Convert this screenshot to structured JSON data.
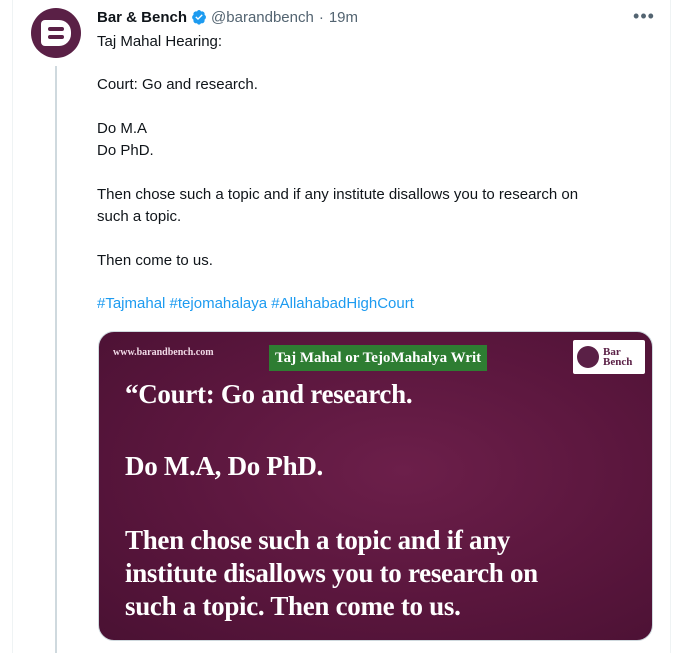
{
  "tweet": {
    "author_name": "Bar & Bench",
    "handle": "@barandbench",
    "separator": "·",
    "time": "19m",
    "lines": [
      "Taj Mahal Hearing:",
      "Court: Go and research.",
      "Do M.A",
      "Do PhD.",
      "Then chose such a topic and if any institute disallows you to research on",
      "such a topic.",
      "Then come to us."
    ],
    "hashtags": [
      "#Tajmahal",
      "#tejomahalaya",
      "#AllahabadHighCourt"
    ]
  },
  "card": {
    "site": "www.barandbench.com",
    "banner": "Taj Mahal or TejoMahalya Writ",
    "logo_line1": "Bar",
    "logo_line2": "Bench",
    "quote_lines": [
      "“Court: Go and research.",
      "Do M.A, Do PhD.",
      "Then chose such a topic and if any",
      "institute disallows you to research on",
      "such a topic. Then come to us."
    ]
  },
  "icons": {
    "avatar": "bar-and-bench-logo",
    "verified": "verified-badge-icon",
    "more": "more-options-icon"
  },
  "colors": {
    "accent": "#1d9bf0",
    "brand": "#5a2046",
    "banner": "#2e7d32"
  }
}
